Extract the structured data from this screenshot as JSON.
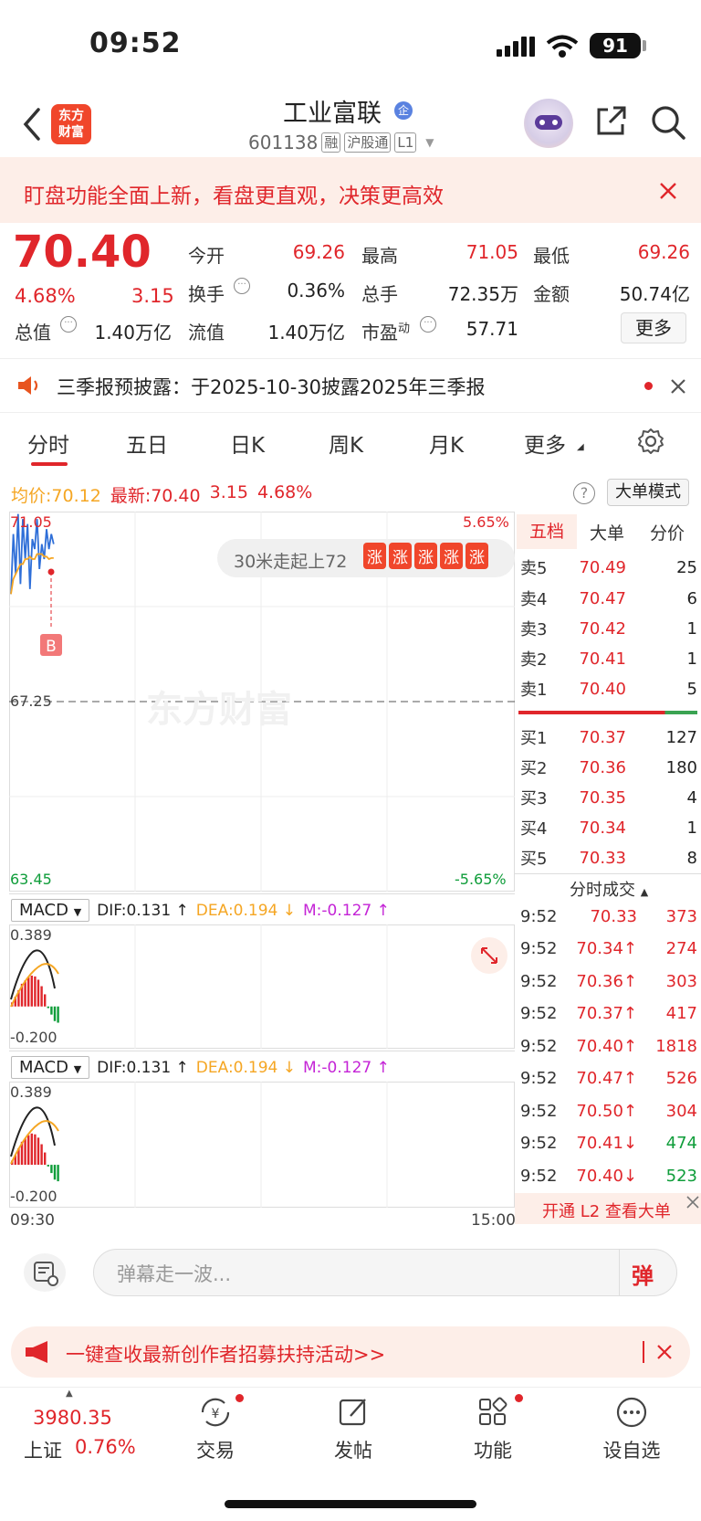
{
  "status_bar": {
    "time": "09:52",
    "battery": "91"
  },
  "header": {
    "logo_text": "东方财富",
    "stock_name": "工业富联",
    "stock_code": "601138",
    "tags": [
      "融",
      "沪股通",
      "L1"
    ]
  },
  "notice": {
    "text": "盯盘功能全面上新，看盘更直观，决策更高效"
  },
  "quote": {
    "price": "70.40",
    "change_pct": "4.68%",
    "change": "3.15",
    "fields": [
      {
        "label": "今开",
        "value": "69.26",
        "color": "#e0262b"
      },
      {
        "label": "最高",
        "value": "71.05",
        "color": "#e0262b"
      },
      {
        "label": "最低",
        "value": "69.26",
        "color": "#e0262b"
      },
      {
        "label": "换手",
        "value": "0.36%",
        "color": "#222222"
      },
      {
        "label": "总手",
        "value": "72.35万",
        "color": "#222222"
      },
      {
        "label": "金额",
        "value": "50.74亿",
        "color": "#222222"
      },
      {
        "label": "总值",
        "value": "1.40万亿",
        "color": "#222222"
      },
      {
        "label": "流值",
        "value": "1.40万亿",
        "color": "#222222"
      },
      {
        "label": "市盈",
        "sup": "动",
        "value": "57.71",
        "color": "#222222"
      }
    ],
    "more_label": "更多"
  },
  "announcement": {
    "text": "三季报预披露：于2025-10-30披露2025年三季报"
  },
  "tabs": [
    "分时",
    "五日",
    "日K",
    "周K",
    "月K",
    "更多"
  ],
  "chart_info": {
    "avg_label": "均价:",
    "avg_value": "70.12",
    "latest_label": "最新:",
    "latest_value": "70.40",
    "change": "3.15",
    "change_pct": "4.68%",
    "mode_btn": "大单模式"
  },
  "chart_data": {
    "type": "line",
    "y_high": "71.05",
    "y_mid": "67.25",
    "y_low": "63.45",
    "pct_high": "5.65%",
    "pct_low": "-5.65%",
    "x_start": "09:30",
    "x_end": "15:00",
    "ylim": [
      63.45,
      71.05
    ],
    "price_series": [
      69.4,
      70.6,
      69.8,
      71.0,
      69.6,
      70.9,
      70.1,
      70.8,
      69.5,
      70.5,
      70.3,
      70.9,
      69.9,
      70.4,
      70.1,
      70.7,
      70.3,
      70.6,
      70.4
    ],
    "avg_series": [
      69.4,
      69.7,
      69.8,
      69.9,
      70.0,
      70.0,
      70.1,
      70.1,
      70.15,
      70.1,
      70.1,
      70.2,
      70.2,
      70.2,
      70.15,
      70.15,
      70.1,
      70.12,
      70.12
    ],
    "marker": "B",
    "banner_text": "30米走起上72",
    "banner_badge": "涨",
    "watermark": "东方财富"
  },
  "order_book": {
    "tabs": [
      "五档",
      "大单",
      "分价"
    ],
    "asks": [
      {
        "label": "卖5",
        "price": "70.49",
        "vol": "25"
      },
      {
        "label": "卖4",
        "price": "70.47",
        "vol": "6"
      },
      {
        "label": "卖3",
        "price": "70.42",
        "vol": "1"
      },
      {
        "label": "卖2",
        "price": "70.41",
        "vol": "1"
      },
      {
        "label": "卖1",
        "price": "70.40",
        "vol": "5"
      }
    ],
    "bids": [
      {
        "label": "买1",
        "price": "70.37",
        "vol": "127"
      },
      {
        "label": "买2",
        "price": "70.36",
        "vol": "180"
      },
      {
        "label": "买3",
        "price": "70.35",
        "vol": "4"
      },
      {
        "label": "买4",
        "price": "70.34",
        "vol": "1"
      },
      {
        "label": "买5",
        "price": "70.33",
        "vol": "8"
      }
    ]
  },
  "trades": {
    "title": "分时成交",
    "rows": [
      {
        "time": "9:52",
        "price": "70.33",
        "dir": "",
        "vol": "373",
        "color": "#e0262b"
      },
      {
        "time": "9:52",
        "price": "70.34↑",
        "dir": "up",
        "vol": "274",
        "color": "#e0262b"
      },
      {
        "time": "9:52",
        "price": "70.36↑",
        "dir": "up",
        "vol": "303",
        "color": "#e0262b"
      },
      {
        "time": "9:52",
        "price": "70.37↑",
        "dir": "up",
        "vol": "417",
        "color": "#e0262b"
      },
      {
        "time": "9:52",
        "price": "70.40↑",
        "dir": "up",
        "vol": "1818",
        "color": "#e0262b"
      },
      {
        "time": "9:52",
        "price": "70.47↑",
        "dir": "up",
        "vol": "526",
        "color": "#e0262b"
      },
      {
        "time": "9:52",
        "price": "70.50↑",
        "dir": "up",
        "vol": "304",
        "color": "#e0262b"
      },
      {
        "time": "9:52",
        "price": "70.41↓",
        "dir": "down",
        "vol": "474",
        "color": "#0f9d3a"
      },
      {
        "time": "9:52",
        "price": "70.40↓",
        "dir": "down",
        "vol": "523",
        "color": "#0f9d3a"
      }
    ],
    "l2_banner": "开通 L2 查看大单"
  },
  "macd": {
    "name": "MACD",
    "dif": "DIF:0.131 ↑",
    "dea": "DEA:0.194 ↓",
    "m": "M:-0.127 ↑",
    "top": "0.389",
    "bottom": "-0.200",
    "bars": [
      0.05,
      0.12,
      0.2,
      0.28,
      0.32,
      0.36,
      0.38,
      0.37,
      0.33,
      0.25,
      0.15,
      -0.02,
      -0.1,
      -0.18,
      -0.2
    ]
  },
  "danmu": {
    "placeholder": "弹幕走一波...",
    "send_label": "弹"
  },
  "promo": {
    "text": "一键查收最新创作者招募扶持活动>>"
  },
  "bottom_nav": {
    "index_value": "3980.35",
    "index_name": "上证",
    "index_change": "0.76%",
    "items": [
      "交易",
      "发帖",
      "功能",
      "设自选"
    ]
  }
}
